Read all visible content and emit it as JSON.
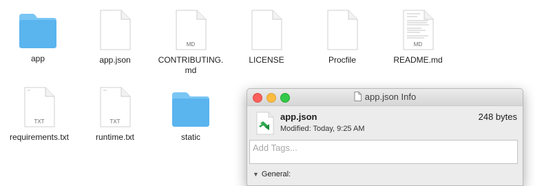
{
  "files": [
    {
      "name": "app",
      "kind": "folder"
    },
    {
      "name": "app.json",
      "kind": "doc"
    },
    {
      "name": "CONTRIBUTING.\nmd",
      "kind": "doc",
      "badge": "MD"
    },
    {
      "name": "LICENSE",
      "kind": "doc"
    },
    {
      "name": "Procfile",
      "kind": "doc"
    },
    {
      "name": "README.md",
      "kind": "doc-preview",
      "badge": "MD"
    },
    {
      "name": "requirements.txt",
      "kind": "doc",
      "badge": "TXT"
    },
    {
      "name": "runtime.txt",
      "kind": "doc",
      "badge": "TXT"
    },
    {
      "name": "static",
      "kind": "folder"
    }
  ],
  "info_window": {
    "title": "app.json Info",
    "file_name": "app.json",
    "modified": "Modified: Today, 9:25 AM",
    "size": "248 bytes",
    "tags_placeholder": "Add Tags...",
    "section_general": "General:"
  },
  "colors": {
    "folder": "#5ab4ee",
    "folder_tab": "#79c6f4",
    "accent_vscode": "#2fa84f"
  }
}
